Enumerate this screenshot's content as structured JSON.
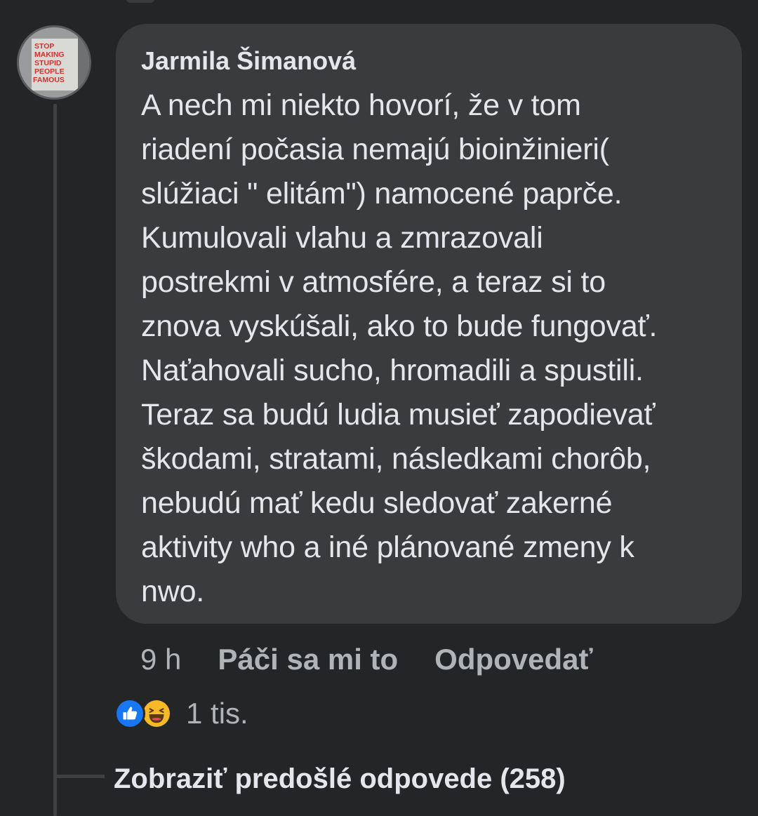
{
  "comment": {
    "author": "Jarmila Šimanová",
    "avatar_text": [
      "STOP",
      "MAKING",
      "STUPID",
      "PEOPLE",
      "FAMOUS"
    ],
    "text": "A nech mi niekto hovorí, že v tom\nriadení počasia nemajú bioinžinieri(\nslúžiaci \" elitám\") namocené paprče.\nKumulovali vlahu a zmrazovali\npostrekmi v atmosfére, a teraz si to\nznova vyskúšali, ako to bude fungovať.\nNaťahovali sucho, hromadili a spustili.\nTeraz sa budú ludia musieť zapodievať\nškodami, stratami, následkami chorôb,\nnebudú mať kedu sledovať zakerné\naktivity who a iné plánované zmeny k\nnwo.",
    "time": "9 h",
    "like_label": "Páči sa mi to",
    "reply_label": "Odpovedať",
    "reactions": {
      "icons": [
        "like-icon",
        "haha-icon"
      ],
      "count": "1 tis."
    }
  },
  "thread": {
    "show_previous_label": "Zobraziť predošlé odpovede (258)"
  },
  "colors": {
    "background": "#242526",
    "bubble": "#3a3b3c",
    "primary_text": "#e4e6eb",
    "secondary_text": "#b0b3b8",
    "like_blue": "#1877f2",
    "haha_yellow": "#f7b928"
  }
}
